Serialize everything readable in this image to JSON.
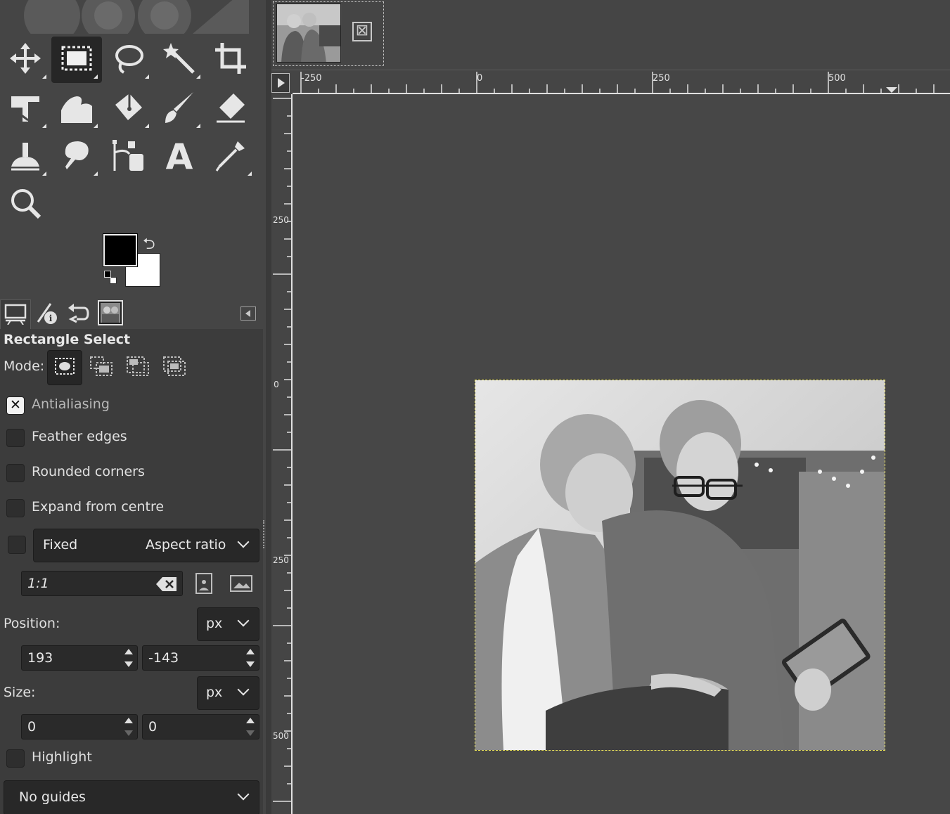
{
  "toolbox": {
    "tools": [
      {
        "name": "move-tool"
      },
      {
        "name": "rectangle-select-tool",
        "active": true
      },
      {
        "name": "free-select-tool"
      },
      {
        "name": "fuzzy-select-tool"
      },
      {
        "name": "crop-tool"
      },
      {
        "name": "unified-transform-tool"
      },
      {
        "name": "warp-transform-tool"
      },
      {
        "name": "bucket-fill-tool"
      },
      {
        "name": "paintbrush-tool"
      },
      {
        "name": "eraser-tool"
      },
      {
        "name": "clone-tool"
      },
      {
        "name": "smudge-tool"
      },
      {
        "name": "paths-tool"
      },
      {
        "name": "text-tool",
        "glyph": "A"
      },
      {
        "name": "color-picker-tool"
      },
      {
        "name": "zoom-tool"
      }
    ],
    "fg_color": "#000000",
    "bg_color": "#ffffff"
  },
  "dock_tabs": [
    "tool-options",
    "device-status",
    "undo-history",
    "images"
  ],
  "tool_options": {
    "title": "Rectangle Select",
    "mode_label": "Mode:",
    "antialiasing": {
      "label": "Antialiasing",
      "checked": true
    },
    "feather": {
      "label": "Feather edges",
      "checked": false
    },
    "rounded": {
      "label": "Rounded corners",
      "checked": false
    },
    "expand": {
      "label": "Expand from centre",
      "checked": false
    },
    "fixed": {
      "checked": false,
      "label": "Fixed",
      "value": "Aspect ratio"
    },
    "ratio_value": "1:1",
    "position": {
      "label": "Position:",
      "unit": "px",
      "x": "193",
      "y": "-143"
    },
    "size": {
      "label": "Size:",
      "unit": "px",
      "w": "0",
      "h": "0"
    },
    "highlight": {
      "label": "Highlight",
      "checked": false
    },
    "guides": "No guides"
  },
  "rulers": {
    "h_labels": [
      "-250",
      "0",
      "250",
      "500"
    ],
    "v_labels": [
      "250",
      "0",
      "250",
      "500"
    ]
  },
  "colors": {
    "bg": "#454545",
    "selection_marching_ants": "#e8e05a"
  }
}
